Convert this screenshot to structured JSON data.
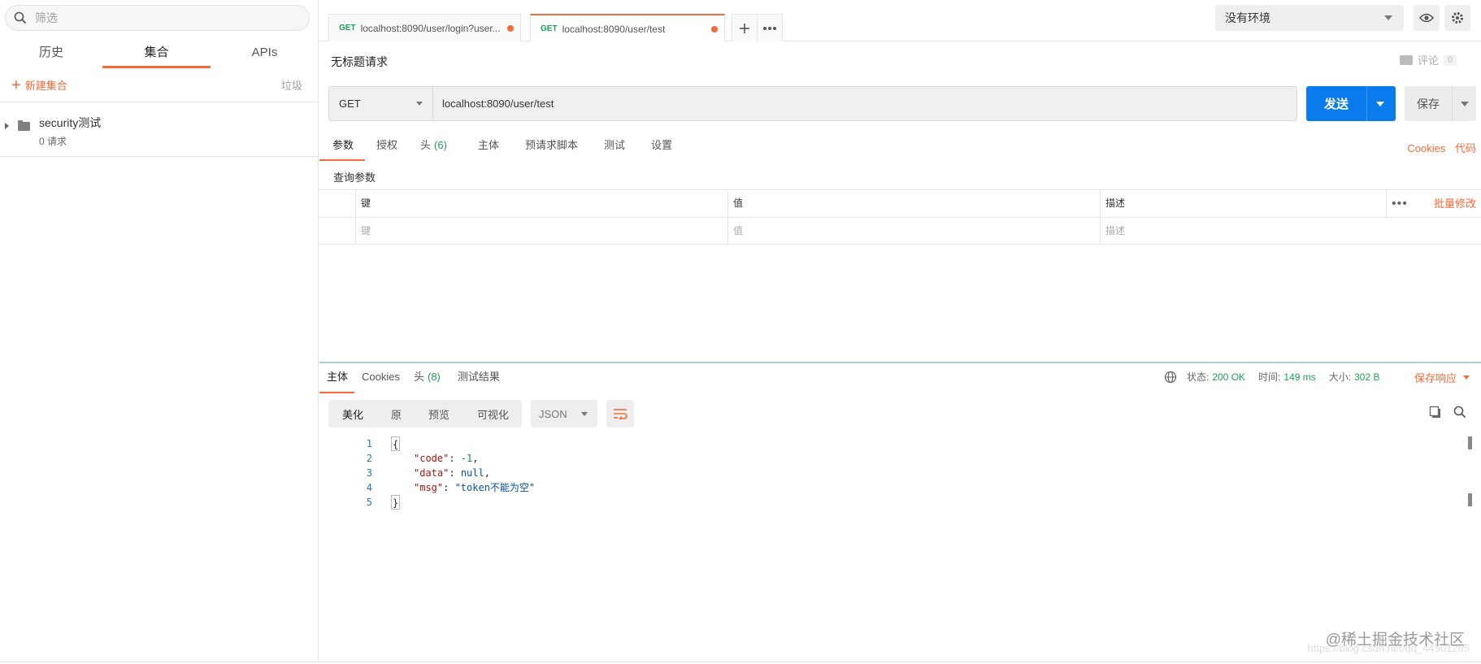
{
  "sidebar": {
    "filter_placeholder": "筛选",
    "tabs": [
      {
        "label": "历史"
      },
      {
        "label": "集合"
      },
      {
        "label": "APIs"
      }
    ],
    "new_collection": "新建集合",
    "trash": "垃圾",
    "collections": [
      {
        "name": "security测试",
        "count": "0 请求"
      }
    ]
  },
  "tabs": [
    {
      "method": "GET",
      "label": "localhost:8090/user/login?user..."
    },
    {
      "method": "GET",
      "label": "localhost:8090/user/test"
    }
  ],
  "environment": {
    "selected": "没有环境"
  },
  "request": {
    "title": "无标题请求",
    "comments_label": "评论",
    "comments_count": "0",
    "method": "GET",
    "url": "localhost:8090/user/test",
    "send_label": "发送",
    "save_label": "保存",
    "subtabs": [
      {
        "label": "参数",
        "count": ""
      },
      {
        "label": "授权",
        "count": ""
      },
      {
        "label": "头",
        "count": "(6)"
      },
      {
        "label": "主体",
        "count": ""
      },
      {
        "label": "预请求脚本",
        "count": ""
      },
      {
        "label": "测试",
        "count": ""
      },
      {
        "label": "设置",
        "count": ""
      }
    ],
    "cookies_link": "Cookies",
    "code_link": "代码",
    "query_title": "查询参数",
    "table": {
      "headers": {
        "key": "键",
        "value": "值",
        "description": "描述"
      },
      "placeholders": {
        "key": "键",
        "value": "值",
        "description": "描述"
      },
      "bulk_edit": "批量修改"
    }
  },
  "response": {
    "subtabs": [
      {
        "label": "主体",
        "count": ""
      },
      {
        "label": "Cookies",
        "count": ""
      },
      {
        "label": "头",
        "count": "(8)"
      },
      {
        "label": "测试结果",
        "count": ""
      }
    ],
    "status_label": "状态:",
    "status_value": "200 OK",
    "time_label": "时间:",
    "time_value": "149 ms",
    "size_label": "大小:",
    "size_value": "302 B",
    "save_response": "保存响应",
    "view_modes": [
      "美化",
      "原",
      "预览",
      "可视化"
    ],
    "format": "JSON",
    "body_lines": [
      {
        "n": "1",
        "text": "{"
      },
      {
        "n": "2",
        "key": "\"code\"",
        "value": "-1",
        "type": "num",
        "trail": ","
      },
      {
        "n": "3",
        "key": "\"data\"",
        "value": "null",
        "type": "null",
        "trail": ","
      },
      {
        "n": "4",
        "key": "\"msg\"",
        "value": "\"token不能为空\"",
        "type": "str",
        "trail": ""
      },
      {
        "n": "5",
        "text": "}"
      }
    ]
  },
  "watermark": "@稀土掘金技术社区",
  "watermark_url": "https://blog.csdn.net/qq_44501285",
  "colors": {
    "accent": "#f26b3a",
    "primary": "#097bed",
    "success": "#1f9d55"
  }
}
